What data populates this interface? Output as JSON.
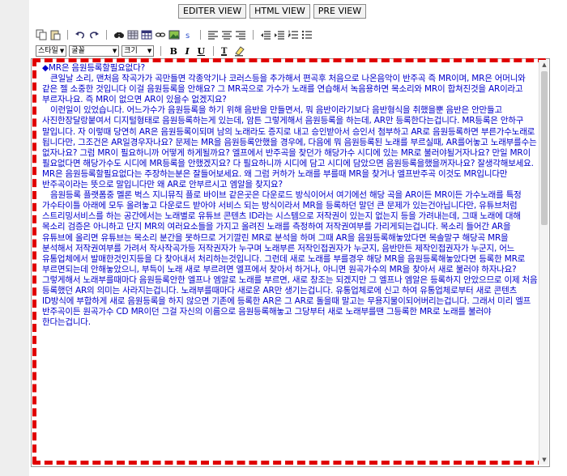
{
  "view_buttons": {
    "editor": "EDITER VIEW",
    "html": "HTML VIEW",
    "pre": "PRE VIEW"
  },
  "toolbar": {
    "font_style": "스타일",
    "font_face": "굴꼴",
    "font_size": "크기",
    "bold": "B",
    "italic": "I",
    "underline": "U",
    "text_color": "T"
  },
  "editor": {
    "title_line": "◆MR은 음원등록할필요없다?",
    "paragraphs": [
      "큰일날 소리, 맨처음 작곡가가 곡만들면 각종악기나 코러스등을 추가해서 편곡후 처음으로 나온음악이 반주곡 즉 MR이며, MR은 어머니와 같은 젤 소중한 것입니다 이걸 음원등록을 안해요? 그 MR곡으로 가수가 노래를 연습해서 녹음용하면 목소리와 MR이 합쳐진것을 AR이라고 부르자나요. 즉 MR이 없으면 AR이 있을수 없겠지요?",
      "이런일이 있었습니다. 어느가수가 음원등록을 하기 위해 음반을 만들면서, 뭐 음반이라기보다 음반형식을 취했을뿐 음반은 안만들고 사진한장달랑붙여서 디지털형태로 음원등록하는게 있는데, 암튼 그렇게해서 음원등록을 하는데, AR만 등록한다는겁니다. MR등록은 안하구 말입니다. 자 이렇때 당연히 AR은 음원등록이되며 남의 노래라도 증지로 내고 승인받아서 승인서 첨부하고 AR로 음원등록하면 부른가수노래로 됩니다만, 그조건은 AR일경우자나요? 문제는 MR을 음원등록안했을 경우에, 다음에 뭐 음원등록된 노래를 부르실때, AR를어놓고 노래부를수는 없자나요? 그럼 MR이 필요하니까 어떻게 하게될까요? 엘프에서 반주곡을 찾던가 해당가수 시디에 있는 MR로 불러야될거자나요? 만일 MR이 필요없다면 해당가수도 시디에 MR등록을 안했겠지요? 다 필요하니까 시디에 담고 시디에 담았으면 음원등록을했을꺼자나요? 잘생각해보세요. MR은 음원등록할필요없다는 주장하는분은 잘들어보세요. 왜 그럼 커하가 노래를 부를때 MR을 찾거나 엘프반주곡 이것도 MR입니다만 반주곡이라는 뜻으로 말입니다만 왜 AR로 안부르시고 엠알을 찾지요?",
      "음원등록 플랫폼중 멜론 벅스 지니뮤직 플로 바이브 같은곳은 다운로드 방식이어서 여기에선 해당 곡을 AR이든 MR이든 가수노래를 특정 가수타이틀 아래에 모두 올려놓고 다운로드 받아야 서비스 되는 방식이라서 MR을 등록하던 말던 큰 문제가 있는건아닙니다만, 유튜브처럼 스트리밍서비스를 하는 공간에서는 노래별로 유튜브 콘텐츠 ID라는 시스템으로 저작권이 있는지 없는지 등을 가려내는데, 그때 노래에 대해 목소리 검증은 아니하고 단지 MR의 여러요소들을 가지고 올려진 노래를 측정하여 저작권여부를 가리게되는겁니다. 목소리 들어간 AR을 유튜브에 올리면 유튜브는 목소리 분간을 못하므로 거기깔린 MR로 분석을 하며 그때 AR을 음원등록해놓았다면 목솔말구 해당곡 MR을 분석해서 저작권여부를 가려서 작사작곡가등 저작권자가 누구며 노래부른 저작인접권자가 누군지, 음반만든 제작인접권자가 누군지, 어느 유통업체에서 발매한것인지등을 다 찾아내서 처리하는것입니다. 그런데 새로 노래를 부를경우 해당 MR을 음원등록해놓았다면 등록한 MR로 부르면되는데 안해놓았으니, 부득이 노래 새로 부르려면 엘프에서 찾아서 하거나, 아니면 원곡가수의 MR을 찾아서 새로 불러야 하자나요? 그렇게해서 노래부를때마다 음원등록안한 엘프나 엠알로 노래를 부르면, 새로 창조는 되겠지만 그 엘프나 엠알은 등록하지 안았으므로 이제 처음 등록했던 AR의 의미는 사라지는겁니다. 노래부를때마다 새로운 AR만 생기는겁니다. 유통업체로에 신고 하여 유통업체로부터 새로 콘텐츠 ID방식에 부합하게 새로 음원등록을 하지 않으면 기존에 등록한 AR은 그 AR로 돌을때 말고는 무용지물이되어버리는겁니다. 그래서 미리 엘프 반주곡이든 원곡가수 CD MR이던 그걸 자신의 이름으로 음원등록해놓고 그당부터 새로 노래부를땐 그등록한 MR로 노래를 불러야 한다는겁니다."
    ]
  }
}
